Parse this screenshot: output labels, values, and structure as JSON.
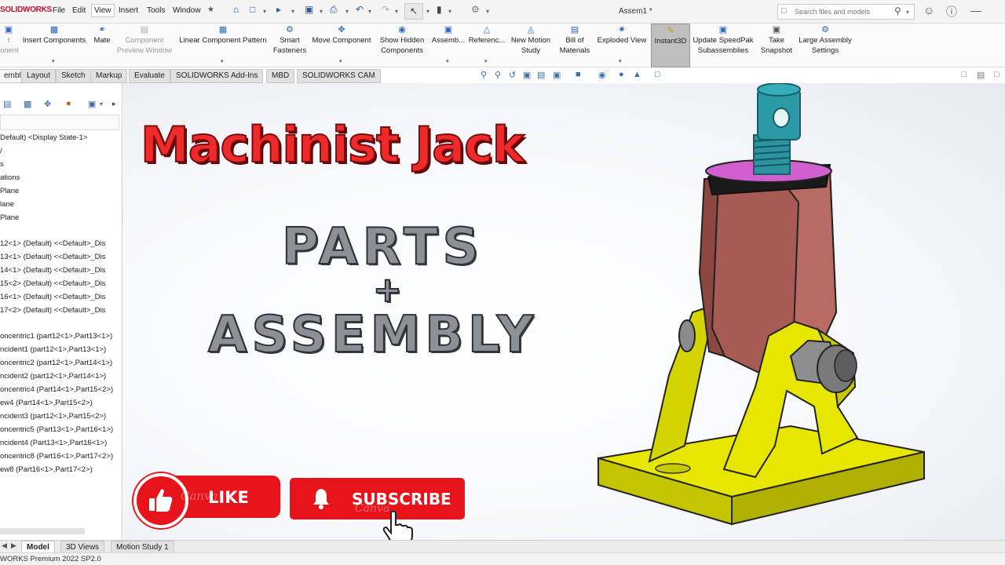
{
  "app": {
    "logo_text": "SOLIDWORKS",
    "document_title": "Assem1 *",
    "menus": [
      "File",
      "Edit",
      "View",
      "Insert",
      "Tools",
      "Window"
    ],
    "search_placeholder": "Search files and models"
  },
  "command_manager": {
    "buttons": [
      {
        "label": "t\nonent",
        "disabled": true
      },
      {
        "label": "Insert Components",
        "disabled": false
      },
      {
        "label": "Mate",
        "disabled": false
      },
      {
        "label": "Component\nPreview Window",
        "disabled": true
      },
      {
        "label": "Linear Component Pattern",
        "disabled": false
      },
      {
        "label": "Smart\nFasteners",
        "disabled": false
      },
      {
        "label": "Move Component",
        "disabled": false
      },
      {
        "label": "Show Hidden\nComponents",
        "disabled": false
      },
      {
        "label": "Assemb...",
        "disabled": false
      },
      {
        "label": "Referenc...",
        "disabled": false
      },
      {
        "label": "New Motion\nStudy",
        "disabled": false
      },
      {
        "label": "Bill of\nMaterials",
        "disabled": false
      },
      {
        "label": "Exploded View",
        "disabled": false
      },
      {
        "label": "Instant3D",
        "disabled": false,
        "active": true
      },
      {
        "label": "Update SpeedPak\nSubassemblies",
        "disabled": false
      },
      {
        "label": "Take\nSnapshot",
        "disabled": false
      },
      {
        "label": "Large Assembly\nSettings",
        "disabled": false
      }
    ]
  },
  "tabs": [
    "embly",
    "Layout",
    "Sketch",
    "Markup",
    "Evaluate",
    "SOLIDWORKS Add-Ins",
    "MBD",
    "SOLIDWORKS CAM"
  ],
  "feature_tree": {
    "items": [
      "Default) <Display State-1>",
      "/",
      "s",
      "ations",
      "Plane",
      "lane",
      "Plane",
      "12<1> (Default) <<Default>_Dis",
      "13<1> (Default) <<Default>_Dis",
      "14<1> (Default) <<Default>_Dis",
      "15<2> (Default) <<Default>_Dis",
      "16<1> (Default) <<Default>_Dis",
      "17<2> (Default) <<Default>_Dis",
      "oncentric1 (part12<1>,Part13<1>)",
      "ncident1 (part12<1>,Part13<1>)",
      "oncentric2 (part12<1>,Part14<1>)",
      "ncident2 (part12<1>,Part14<1>)",
      "oncentric4 (Part14<1>,Part15<2>)",
      "ew4 (Part14<1>,Part15<2>)",
      "ncident3 (part12<1>,Part15<2>)",
      "oncentric5 (Part13<1>,Part16<1>)",
      "ncident4 (Part13<1>,Part16<1>)",
      "oncentric8 (Part16<1>,Part17<2>)",
      "ew8 (Part16<1>,Part17<2>)"
    ]
  },
  "overlay": {
    "title": "Machinist Jack",
    "line1": "PARTS",
    "plus": "+",
    "line2": "ASSEMBLY",
    "like_label": "LIKE",
    "subscribe_label": "SUBSCRIBE",
    "watermark": "Canva"
  },
  "bottom_tabs": [
    "Model",
    "3D Views",
    "Motion Study 1"
  ],
  "status_text": "WORKS Premium 2022 SP2.0",
  "colors": {
    "accent_red": "#e8141c",
    "title_red": "#ee2a2a",
    "base_yellow": "#e6e600",
    "body_red": "#a55050",
    "screw_teal": "#2c93a0",
    "washer_magenta": "#d060d0"
  }
}
